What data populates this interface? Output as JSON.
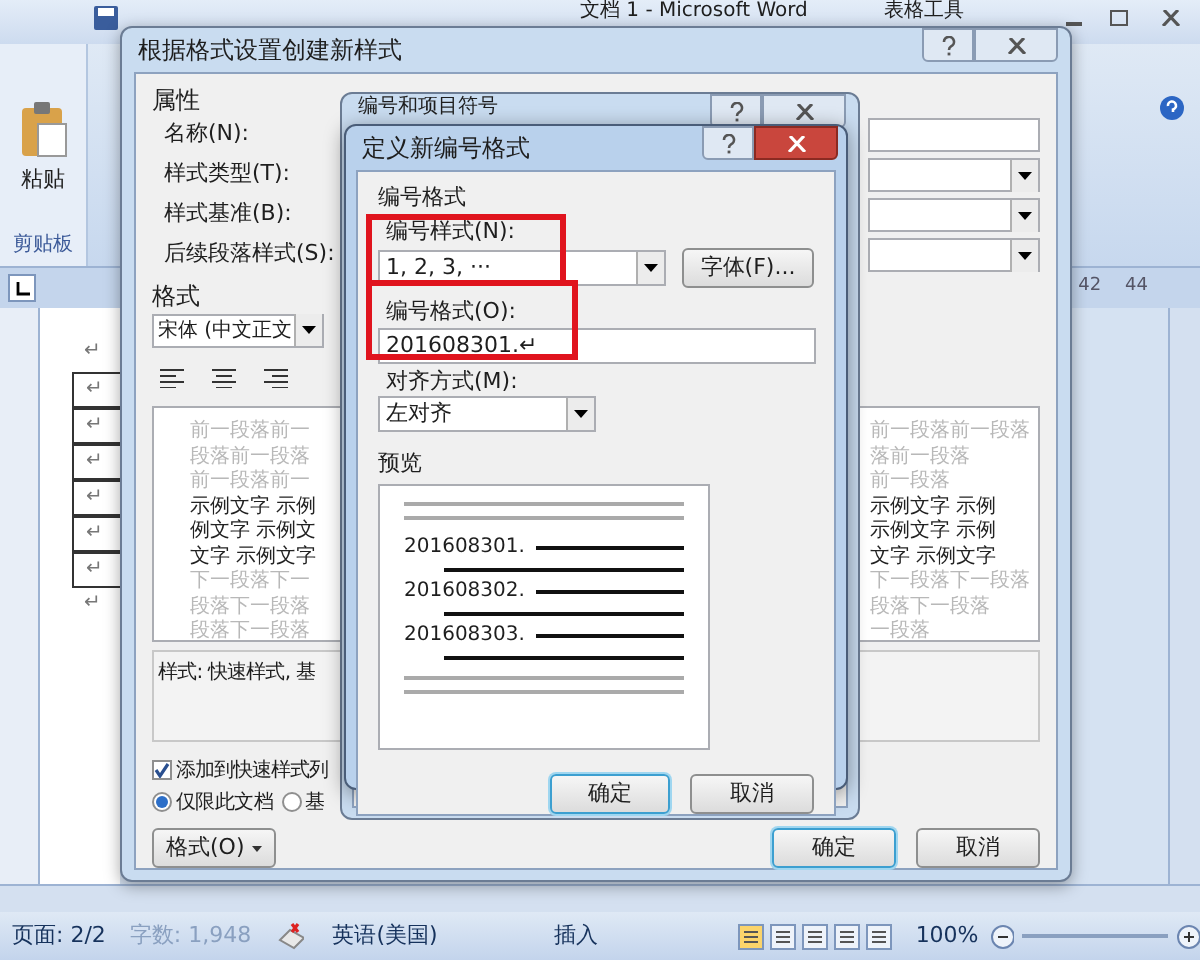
{
  "word_window": {
    "title": "文档 1 - Microsoft Word",
    "context_tab": "表格工具",
    "ribbon": {
      "paste_label": "粘贴",
      "group_label": "剪贴板"
    },
    "ruler_numbers": [
      "42",
      "44"
    ],
    "document_marks": [
      "↵",
      "↵",
      "↵",
      "↵",
      "↵",
      "↵",
      "↵",
      "↵"
    ]
  },
  "create_style_dialog": {
    "title": "根据格式设置创建新样式",
    "properties_label": "属性",
    "property_rows": [
      {
        "label": "名称(N):",
        "kind": "text"
      },
      {
        "label": "样式类型(T):",
        "kind": "select"
      },
      {
        "label": "样式基准(B):",
        "kind": "select"
      },
      {
        "label": "后续段落样式(S):",
        "kind": "select"
      }
    ],
    "format_label": "格式",
    "font": "宋体 (中文正文",
    "preview_left": [
      {
        "text": "前一段落前一",
        "kind": "context"
      },
      {
        "text": "段落前一段落",
        "kind": "context"
      },
      {
        "text": "前一段落前一",
        "kind": "context"
      },
      {
        "text": "示例文字 示例",
        "kind": "sample"
      },
      {
        "text": "例文字 示例文",
        "kind": "sample"
      },
      {
        "text": "文字 示例文字",
        "kind": "sample"
      },
      {
        "text": "下一段落下一",
        "kind": "context"
      },
      {
        "text": "段落下一段落",
        "kind": "context"
      },
      {
        "text": "段落下一段落",
        "kind": "context"
      }
    ],
    "preview_right": [
      {
        "text": "前一段落前一段落",
        "kind": "context"
      },
      {
        "text": "落前一段落",
        "kind": "context"
      },
      {
        "text": "前一段落",
        "kind": "context"
      },
      {
        "text": "示例文字 示例",
        "kind": "sample"
      },
      {
        "text": "示例文字 示例",
        "kind": "sample"
      },
      {
        "text": "文字 示例文字",
        "kind": "sample"
      },
      {
        "text": "下一段落下一段落",
        "kind": "context"
      },
      {
        "text": "段落下一段落",
        "kind": "context"
      },
      {
        "text": "一段落",
        "kind": "context"
      }
    ],
    "description": "样式: 快速样式, 基",
    "add_to_quick": {
      "label": "添加到快速样式列",
      "checked": true
    },
    "scope": [
      {
        "label": "仅限此文档",
        "selected": true
      },
      {
        "label": "基",
        "selected": false
      }
    ],
    "format_button": "格式(O)",
    "ok": "确定",
    "cancel": "取消"
  },
  "numbering_dialog": {
    "title": "编号和项目符号"
  },
  "define_format_dialog": {
    "title": "定义新编号格式",
    "group_label": "编号格式",
    "style_label": "编号样式(N):",
    "style_value": "1, 2, 3, ···",
    "font_button": "字体(F)...",
    "format_label": "编号格式(O):",
    "format_value": "201608301.↵",
    "alignment_label": "对齐方式(M):",
    "alignment_value": "左对齐",
    "preview_label": "预览",
    "preview_items": [
      "201608301.",
      "201608302.",
      "201608303."
    ],
    "ok": "确定",
    "cancel": "取消"
  },
  "status_bar": {
    "page": "页面: 2/2",
    "word_count": "字数: 1,948",
    "language": "英语(美国)",
    "mode": "插入",
    "zoom": "100%"
  }
}
